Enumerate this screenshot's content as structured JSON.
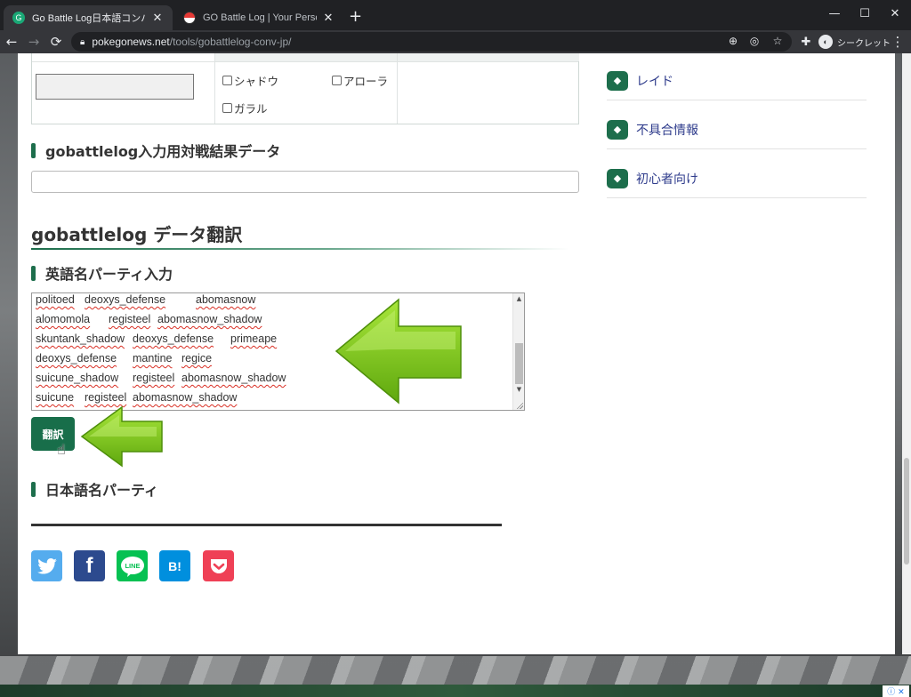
{
  "browser": {
    "tabs": [
      {
        "title": "Go Battle Log日本語コンバーター｜",
        "close": "✕"
      },
      {
        "title": "GO Battle Log | Your Personal Ba",
        "close": "✕"
      }
    ],
    "new_tab": "+",
    "window_controls": {
      "minimize": "—",
      "maximize": "☐",
      "close": "✕"
    },
    "url_host": "pokegonews.net",
    "url_path": "/tools/gobattlelog-conv-jp/",
    "incognito_label": "シークレット"
  },
  "settings": {
    "checkboxes": [
      "シャドウ",
      "アローラ",
      "ガラル"
    ]
  },
  "section_battle_data": {
    "heading": "gobattlelog入力用対戦結果データ",
    "value": ""
  },
  "section_translate": {
    "heading": "gobattlelog データ翻訳",
    "input_heading": "英語名パーティ入力",
    "lines": [
      [
        "politoed",
        "deoxys_defense",
        "abomasnow"
      ],
      [
        "alomomola",
        "registeel",
        "abomasnow_shadow"
      ],
      [
        "skuntank_shadow",
        "deoxys_defense",
        "primeape"
      ],
      [
        "deoxys_defense",
        "mantine",
        "regice"
      ],
      [
        "suicune_shadow",
        "registeel",
        "abomasnow_shadow"
      ],
      [
        "suicune",
        "registeel",
        "abomasnow_shadow"
      ]
    ],
    "button_label": "翻訳",
    "output_heading": "日本語名パーティ"
  },
  "share_buttons": [
    "twitter-icon",
    "facebook-icon",
    "line-icon",
    "hatena-bookmark-icon",
    "pocket-icon"
  ],
  "share_labels": {
    "facebook": "f",
    "line": "LINE",
    "hatena": "B!"
  },
  "sidebar": {
    "items": [
      {
        "label": "レイド"
      },
      {
        "label": "不具合情報"
      },
      {
        "label": "初心者向け"
      }
    ]
  },
  "colors": {
    "accent_green": "#1d6e4c",
    "link_blue": "#2f3c8c",
    "arrow_green": "#7cc519",
    "twitter": "#55acee",
    "facebook": "#2c4a8e",
    "line": "#06c152",
    "hatena": "#008fde",
    "pocket": "#ef4056"
  },
  "ad_badge": "ⓘ ✕"
}
